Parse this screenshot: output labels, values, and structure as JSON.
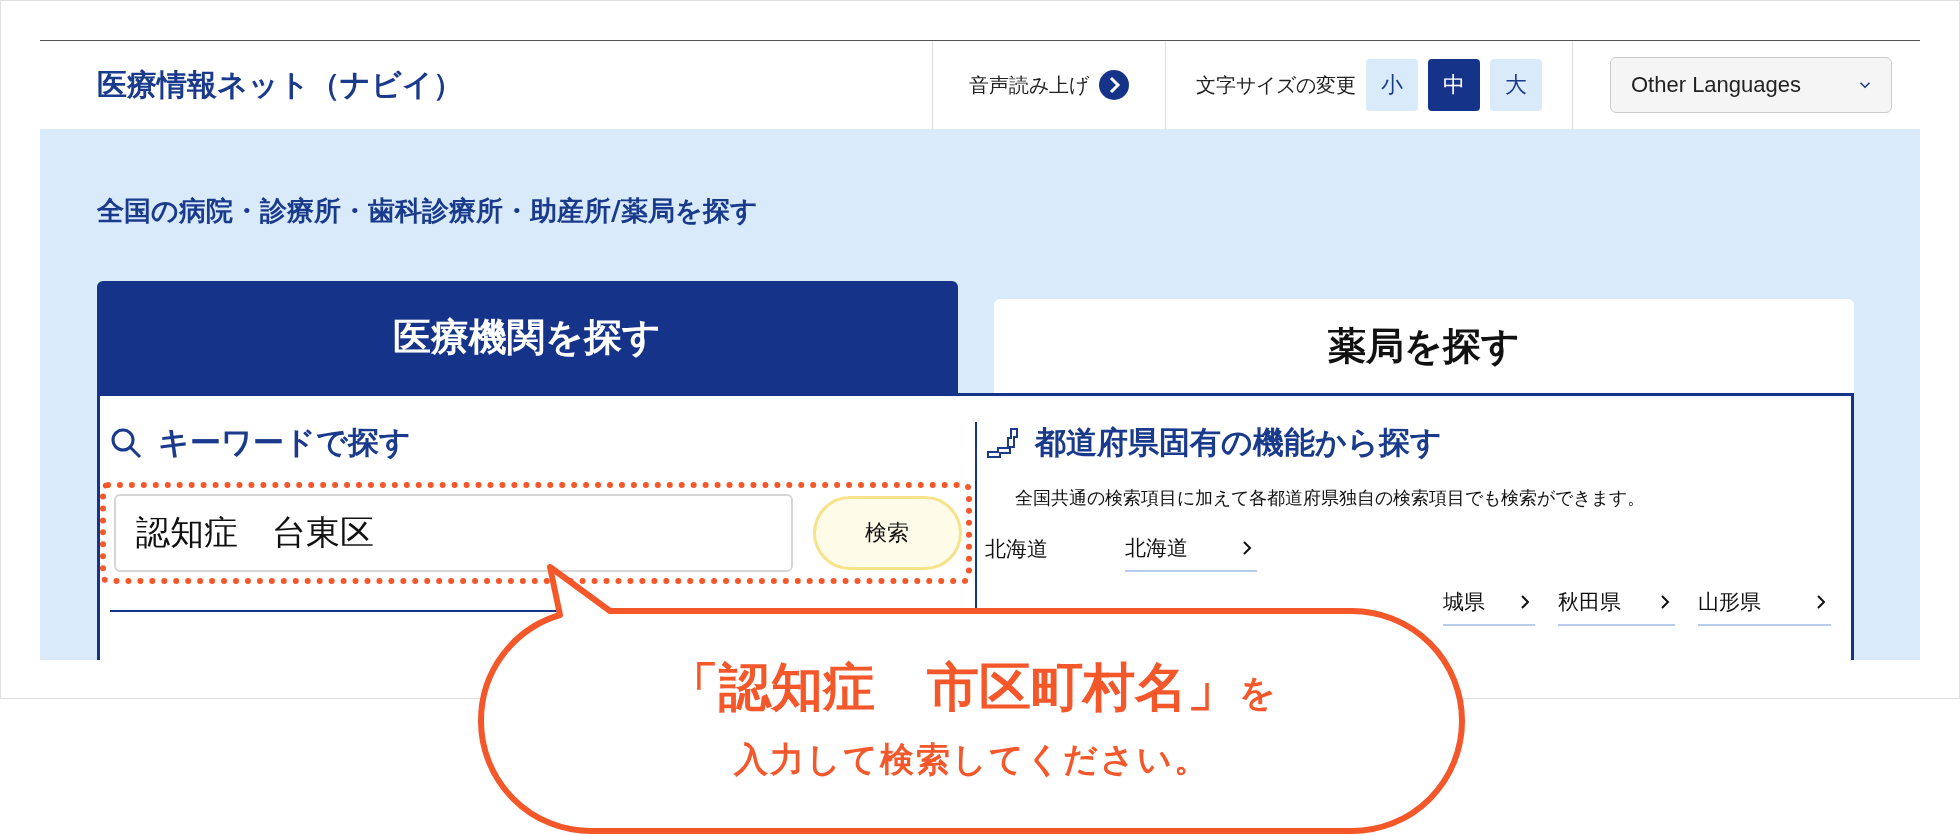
{
  "header": {
    "site_title": "医療情報ネット（ナビイ）",
    "read_aloud": "音声読み上げ",
    "font_size": {
      "label": "文字サイズの変更",
      "options": [
        {
          "label": "小",
          "selected": false
        },
        {
          "label": "中",
          "selected": true
        },
        {
          "label": "大",
          "selected": false
        }
      ]
    },
    "language": "Other Languages"
  },
  "main": {
    "heading": "全国の病院・診療所・歯科診療所・助産所/薬局を探す",
    "tabs": [
      {
        "label": "医療機関を探す",
        "selected": true
      },
      {
        "label": "薬局を探す",
        "selected": false
      }
    ],
    "keyword": {
      "heading": "キーワードで探す",
      "value": "認知症　台東区",
      "button": "検索"
    },
    "prefecture": {
      "heading": "都道府県固有の機能から探す",
      "description": "全国共通の検索項目に加えて各都道府県独自の検索項目でも検索ができます。",
      "rows": [
        {
          "label": "北海道",
          "links": [
            "北海道"
          ]
        },
        {
          "links": [
            "城県",
            "秋田県",
            "山形県"
          ]
        }
      ]
    }
  },
  "callout": {
    "emphasis": "「認知症　市区町村名」",
    "particle": "を",
    "line2": "入力して検索してください。"
  }
}
